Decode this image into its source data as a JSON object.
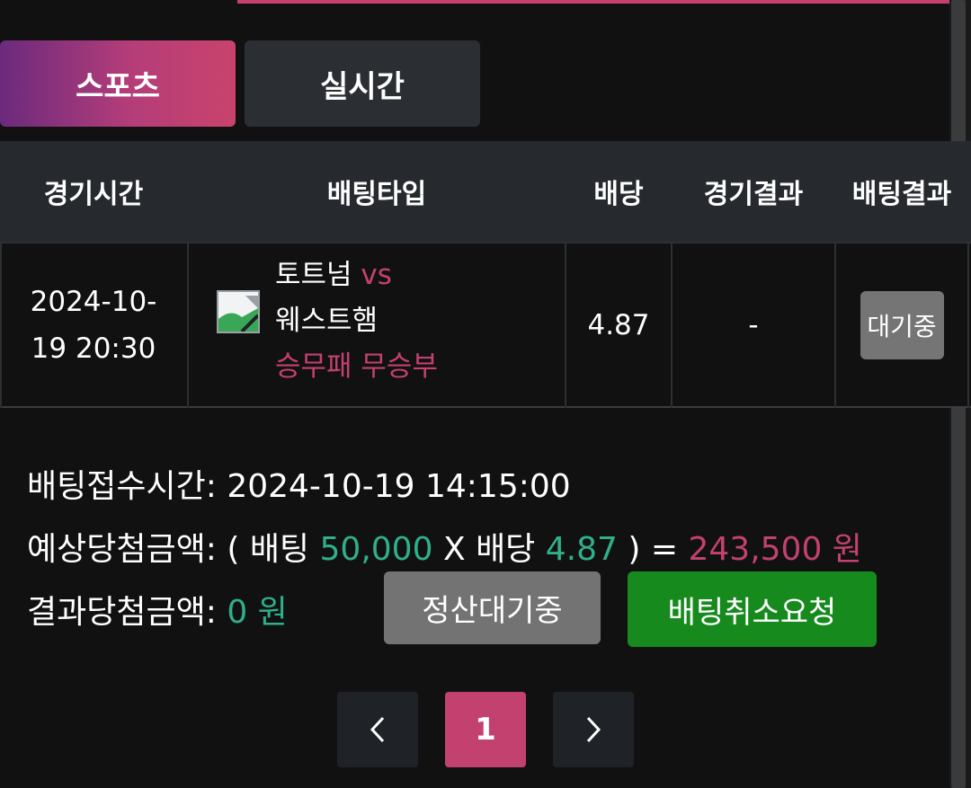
{
  "tabs": [
    {
      "label": "스포츠",
      "active": true
    },
    {
      "label": "실시간",
      "active": false
    }
  ],
  "table": {
    "headers": [
      "경기시간",
      "배팅타입",
      "배당",
      "경기결과",
      "배팅결과"
    ],
    "row": {
      "time_line1": "2024-10-",
      "time_line2": "19 20:30",
      "home_team": "토트넘",
      "vs": "vs",
      "away_team": "웨스트햄",
      "bet_type": "승무패 무승부",
      "odds": "4.87",
      "result": "-",
      "status": "대기중"
    }
  },
  "info": {
    "receipt_label": "배팅접수시간:",
    "receipt_time": "2024-10-19 14:15:00",
    "expected_label": "예상당첨금액:",
    "open_paren": "(",
    "bet_word": "배팅",
    "bet_amount": "50,000",
    "times": "X",
    "odds_word": "배당",
    "odds_value": "4.87",
    "close_eq": ") =",
    "expected_amount": "243,500 원",
    "result_label": "결과당첨금액:",
    "result_amount": "0 원"
  },
  "buttons": {
    "settle": "정산대기중",
    "cancel": "배팅취소요청"
  },
  "pagination": {
    "prev_icon": "chevron-left-icon",
    "current": "1",
    "next_icon": "chevron-right-icon"
  },
  "colors": {
    "accent": "#c3416f",
    "green": "#2fb08a",
    "cancel_button": "#178a1e",
    "header_bg": "#262a2e"
  }
}
